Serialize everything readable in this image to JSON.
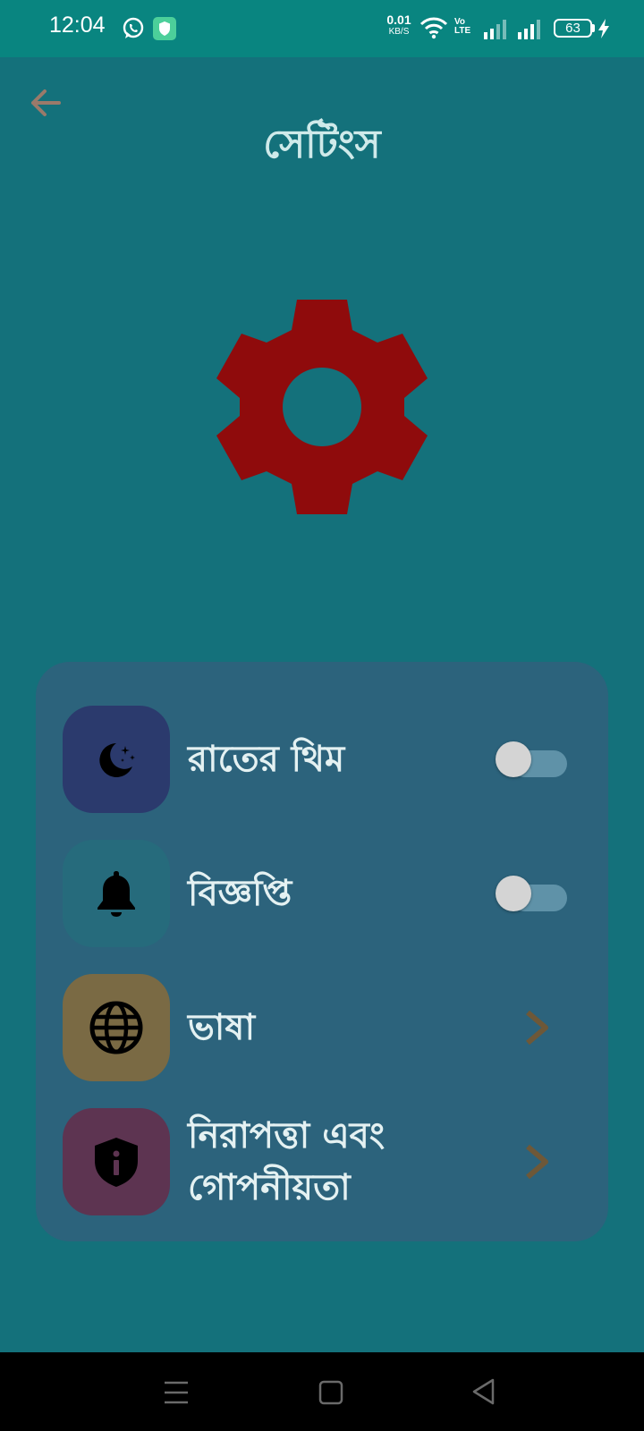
{
  "status_bar": {
    "time": "12:04",
    "net_speed_value": "0.01",
    "net_speed_unit": "KB/S",
    "volte_line1": "Vo",
    "volte_line2": "LTE",
    "battery_level": "63",
    "icons": [
      "whatsapp-icon",
      "shield-icon",
      "wifi-icon",
      "signal-icon",
      "signal-icon",
      "battery-icon",
      "charging-icon"
    ]
  },
  "header": {
    "title": "সেটিংস",
    "back_icon": "arrow-left-icon"
  },
  "hero": {
    "icon": "gear-icon",
    "color": "#8f0b0c"
  },
  "settings": {
    "items": [
      {
        "label": "রাতের থিম",
        "icon": "moon-stars-icon",
        "icon_bg": "#2b3a6d",
        "control": "toggle",
        "enabled": false
      },
      {
        "label": "বিজ্ঞপ্তি",
        "icon": "bell-icon",
        "icon_bg": "#266b7c",
        "control": "toggle",
        "enabled": false
      },
      {
        "label": "ভাষা",
        "icon": "globe-icon",
        "icon_bg": "#7a6a44",
        "control": "chevron"
      },
      {
        "label": "নিরাপত্তা এবং গোপনীয়তা",
        "icon": "shield-info-icon",
        "icon_bg": "#5d3451",
        "control": "chevron"
      }
    ]
  },
  "colors": {
    "background": "#14717b",
    "status_bar": "#098580",
    "card": "#2c637c",
    "chevron": "#6e5838",
    "back_arrow": "#9a7a6a"
  },
  "nav_bar": {
    "icons": [
      "menu-icon",
      "home-icon",
      "back-icon"
    ]
  }
}
